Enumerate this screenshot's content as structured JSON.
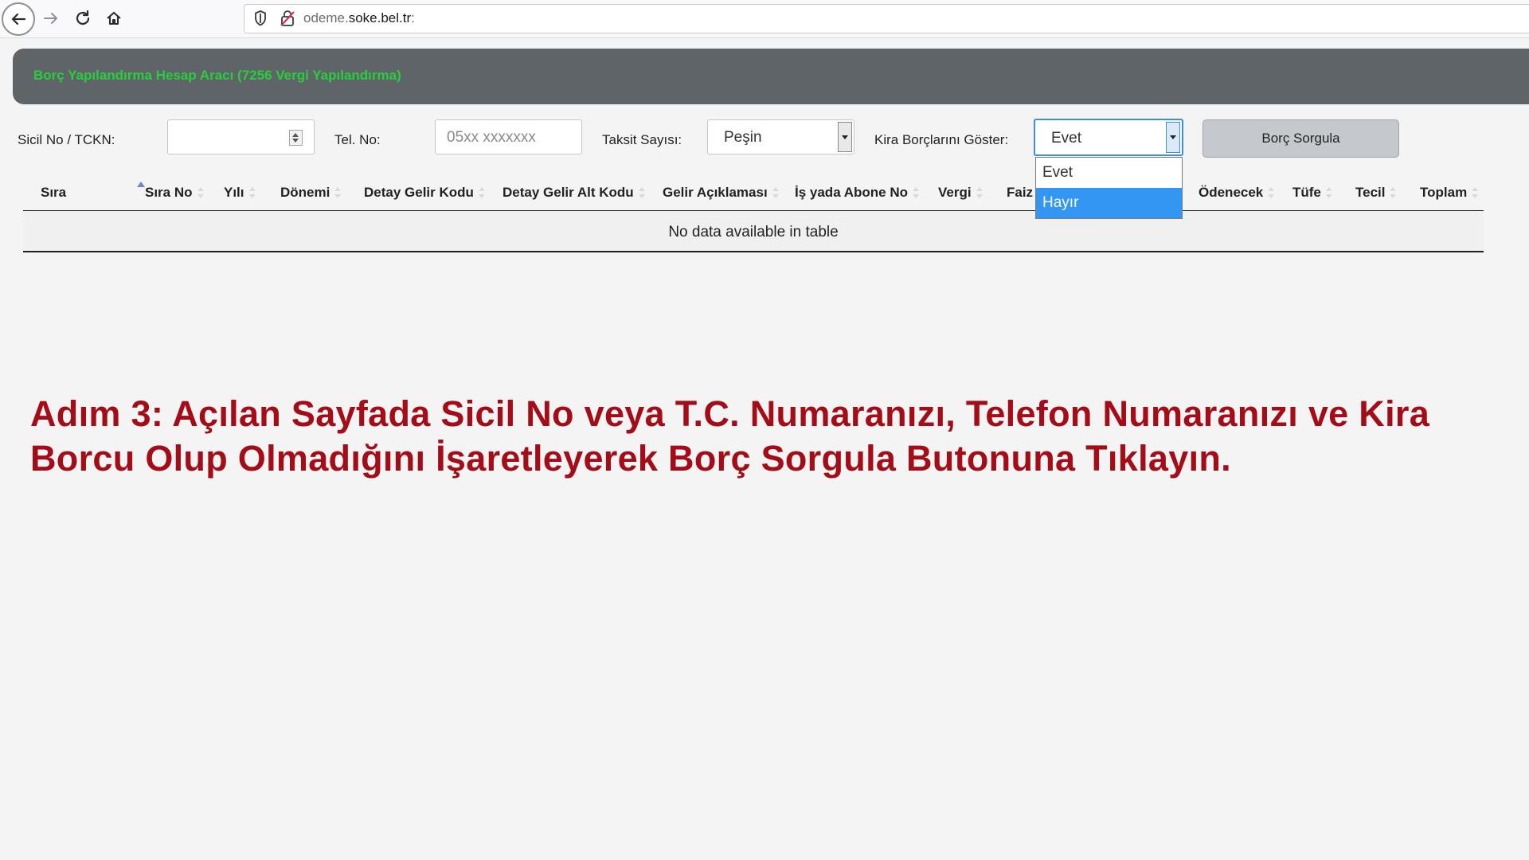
{
  "browser": {
    "url_prefix": "odeme.",
    "url_domain": "soke.bel.tr",
    "url_suffix": ":"
  },
  "page": {
    "title": "Borç Yapılandırma Hesap Aracı (7256 Vergi Yapılandırma)",
    "title_color": "#27cf3a",
    "header_bg": "#5f6468"
  },
  "form": {
    "sicil_label": "Sicil No / TCKN:",
    "sicil_value": "",
    "tel_label": "Tel. No:",
    "tel_placeholder": "05xx xxxxxxx",
    "taksit_label": "Taksit Sayısı:",
    "taksit_value": "Peşin",
    "kira_label": "Kira Borçlarını Göster:",
    "kira_value": "Evet",
    "kira_options": [
      "Evet",
      "Hayır"
    ],
    "kira_highlighted": "Hayır",
    "submit_label": "Borç Sorgula"
  },
  "table": {
    "columns": [
      "Sıra",
      "Sıra No",
      "Yılı",
      "Dönemi",
      "Detay Gelir Kodu",
      "Detay Gelir Alt Kodu",
      "Gelir Açıklaması",
      "İş yada Abone No",
      "Vergi",
      "Faiz",
      "Ödenecek",
      "Tüfe",
      "Tecil",
      "Toplam"
    ],
    "empty_message": "No data available in table"
  },
  "instruction": {
    "text": "Adım 3: Açılan Sayfada Sicil No veya T.C. Numaranızı, Telefon Numaranızı ve Kira Borcu Olup Olmadığını İşaretleyerek Borç Sorgula Butonuna Tıklayın.",
    "color": "#a40c17"
  }
}
